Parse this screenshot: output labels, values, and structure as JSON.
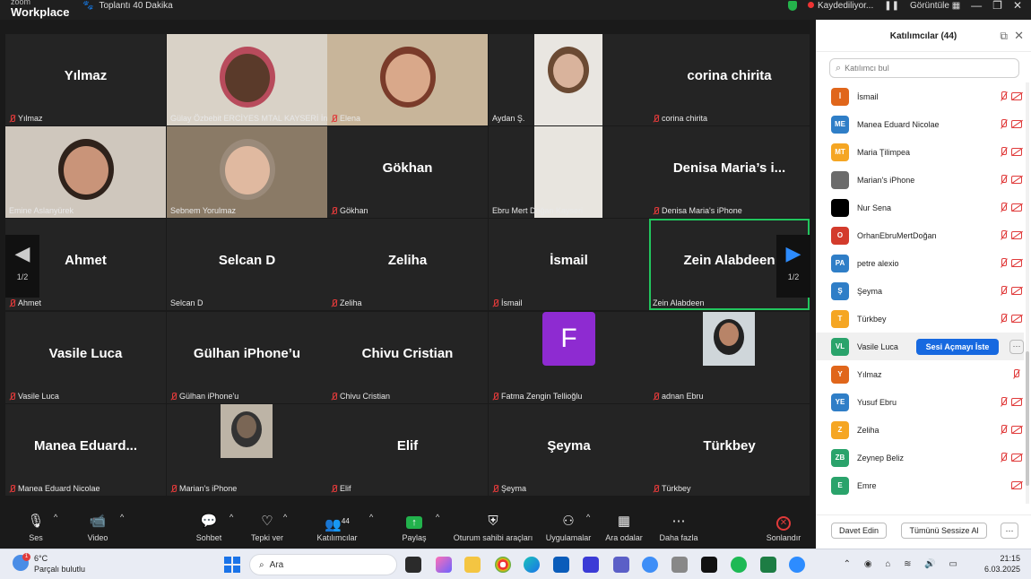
{
  "titlebar": {
    "brand_line1": "zoom",
    "brand_line2": "Workplace",
    "meeting_label": "Toplantı 40 Dakika",
    "recording": "Kaydediliyor...",
    "view": "Görüntüle"
  },
  "tiles": [
    {
      "name": "Yılmaz",
      "label": "Yılmaz",
      "muted": true,
      "video": false
    },
    {
      "name": "",
      "label": "Gülay Özbebit ERCİYES MTAL KAYSERİ İn...",
      "muted": false,
      "video": true
    },
    {
      "name": "",
      "label": "Elena",
      "muted": true,
      "video": true
    },
    {
      "name": "",
      "label": "Aydan Ş.",
      "muted": false,
      "video": true
    },
    {
      "name": "corina chirita",
      "label": "corina chirita",
      "muted": true,
      "video": false
    },
    {
      "name": "",
      "label": "Emine Aslanyürek",
      "muted": false,
      "video": true
    },
    {
      "name": "",
      "label": "Sebnem Yorulmaz",
      "muted": false,
      "video": true
    },
    {
      "name": "Gökhan",
      "label": "Gökhan",
      "muted": true,
      "video": false
    },
    {
      "name": "",
      "label": "Ebru Mert Doğan Kayseri",
      "muted": false,
      "video": true
    },
    {
      "name": "Denisa Maria’s i...",
      "label": "Denisa Maria's iPhone",
      "muted": true,
      "video": false
    },
    {
      "name": "Ahmet",
      "label": "Ahmet",
      "muted": true,
      "video": false
    },
    {
      "name": "Selcan D",
      "label": "Selcan D",
      "muted": false,
      "video": false
    },
    {
      "name": "Zeliha",
      "label": "Zeliha",
      "muted": true,
      "video": false
    },
    {
      "name": "İsmail",
      "label": "İsmail",
      "muted": true,
      "video": false
    },
    {
      "name": "Zein Alabdeen",
      "label": "Zein Alabdeen",
      "muted": false,
      "video": false
    },
    {
      "name": "Vasile Luca",
      "label": "Vasile Luca",
      "muted": true,
      "video": false
    },
    {
      "name": "Gülhan iPhone’u",
      "label": "Gülhan iPhone'u",
      "muted": true,
      "video": false
    },
    {
      "name": "Chivu Cristian",
      "label": "Chivu Cristian",
      "muted": true,
      "video": false
    },
    {
      "name": "F",
      "label": "Fatma Zengin Tellioğlu",
      "muted": true,
      "video": false
    },
    {
      "name": "",
      "label": "adnan Ebru",
      "muted": true,
      "video": true
    },
    {
      "name": "Manea  Eduard...",
      "label": "Manea Eduard Nicolae",
      "muted": true,
      "video": false
    },
    {
      "name": "",
      "label": "Marian's iPhone",
      "muted": true,
      "video": true
    },
    {
      "name": "Elif",
      "label": "Elif",
      "muted": true,
      "video": false
    },
    {
      "name": "Şeyma",
      "label": "Şeyma",
      "muted": true,
      "video": false
    },
    {
      "name": "Türkbey",
      "label": "Türkbey",
      "muted": true,
      "video": false
    }
  ],
  "pager": {
    "left": "1/2",
    "right": "1/2"
  },
  "toolbar": {
    "audio": "Ses",
    "video": "Video",
    "chat": "Sohbet",
    "react": "Tepki ver",
    "participants": "Katılımcılar",
    "participants_count": "44",
    "share": "Paylaş",
    "host_tools": "Oturum sahibi araçları",
    "apps": "Uygulamalar",
    "rooms": "Ara odalar",
    "more": "Daha fazla",
    "end": "Sonlandır"
  },
  "panel": {
    "title": "Katılımcılar (44)",
    "search_placeholder": "Katılımcı bul",
    "ask_unmute": "Sesi Açmayı İste",
    "invite": "Davet Edin",
    "mute_all": "Tümünü Sessize Al",
    "participants": [
      {
        "initials": "İ",
        "name": "İsmail",
        "color": "#e0661b",
        "muted": true,
        "cam_off": true
      },
      {
        "initials": "ME",
        "name": "Manea Eduard Nicolae",
        "color": "#2f7ec7",
        "muted": true,
        "cam_off": true
      },
      {
        "initials": "MT",
        "name": "Maria Ţilimpea",
        "color": "#f5a623",
        "muted": true,
        "cam_off": true
      },
      {
        "initials": "",
        "name": "Marian's iPhone",
        "color": "#6b6b6b",
        "muted": true,
        "cam_off": true
      },
      {
        "initials": "",
        "name": "Nur Sena",
        "color": "#000000",
        "muted": true,
        "cam_off": true
      },
      {
        "initials": "O",
        "name": "OrhanEbruMertDoğan",
        "color": "#d33b2c",
        "muted": true,
        "cam_off": true
      },
      {
        "initials": "PA",
        "name": "petre alexio",
        "color": "#2f7ec7",
        "muted": true,
        "cam_off": true
      },
      {
        "initials": "Ş",
        "name": "Şeyma",
        "color": "#2f7ec7",
        "muted": true,
        "cam_off": true
      },
      {
        "initials": "T",
        "name": "Türkbey",
        "color": "#f5a623",
        "muted": true,
        "cam_off": true
      },
      {
        "initials": "VL",
        "name": "Vasile Luca",
        "color": "#2aa36b",
        "muted": false,
        "cam_off": false
      },
      {
        "initials": "Y",
        "name": "Yılmaz",
        "color": "#e0661b",
        "muted": true,
        "cam_off": false
      },
      {
        "initials": "YE",
        "name": "Yusuf Ebru",
        "color": "#2f7ec7",
        "muted": true,
        "cam_off": true
      },
      {
        "initials": "Z",
        "name": "Zeliha",
        "color": "#f5a623",
        "muted": true,
        "cam_off": true
      },
      {
        "initials": "ZB",
        "name": "Zeynep Beliz",
        "color": "#2aa36b",
        "muted": true,
        "cam_off": true
      },
      {
        "initials": "E",
        "name": "Emre",
        "color": "#2aa36b",
        "muted": false,
        "cam_off": true
      }
    ]
  },
  "taskbar": {
    "temp": "6°C",
    "weather": "Parçalı bulutlu",
    "weather_badge": "1",
    "search": "Ara",
    "time": "21:15",
    "date": "6.03.2025"
  }
}
